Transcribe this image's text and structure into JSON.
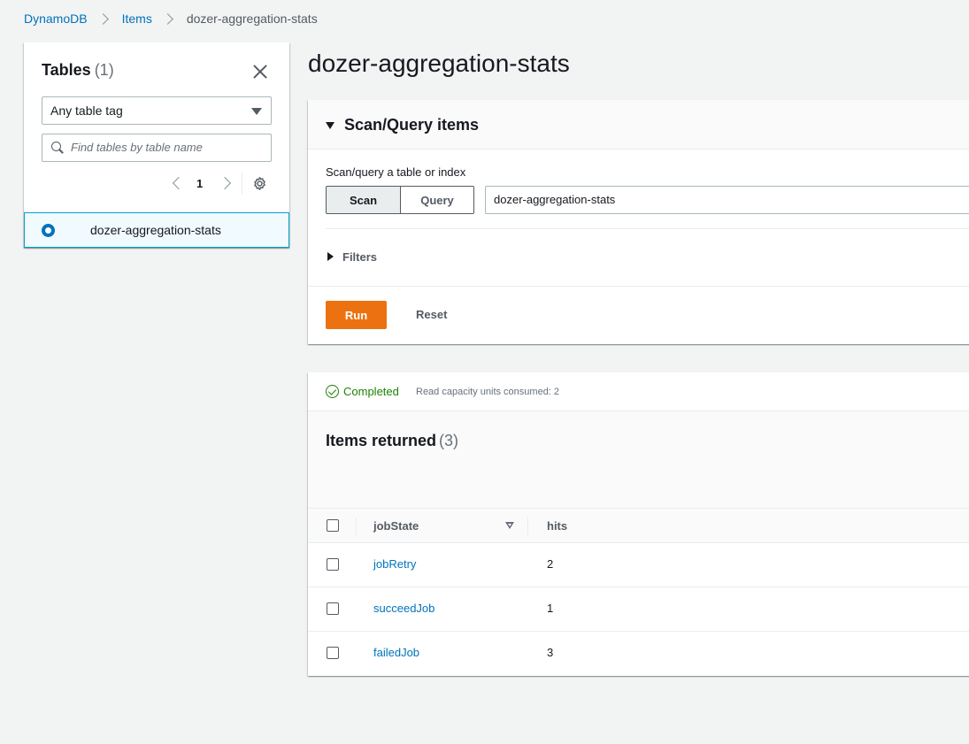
{
  "breadcrumb": {
    "items": [
      "DynamoDB",
      "Items"
    ],
    "current": "dozer-aggregation-stats"
  },
  "tables_panel": {
    "title": "Tables",
    "count": "(1)",
    "tag_filter": "Any table tag",
    "search_placeholder": "Find tables by table name",
    "page": "1",
    "tables": [
      {
        "name": "dozer-aggregation-stats",
        "selected": true
      }
    ]
  },
  "page_title": "dozer-aggregation-stats",
  "scan_query": {
    "title": "Scan/Query items",
    "label": "Scan/query a table or index",
    "mode_options": [
      "Scan",
      "Query"
    ],
    "selected_mode": "Scan",
    "selected_table": "dozer-aggregation-stats",
    "filters_label": "Filters",
    "run_label": "Run",
    "reset_label": "Reset"
  },
  "results": {
    "status": "Completed",
    "capacity": "Read capacity units consumed: 2",
    "title": "Items returned",
    "count": "(3)",
    "columns": [
      "jobState",
      "hits"
    ],
    "rows": [
      {
        "jobState": "jobRetry",
        "hits": "2"
      },
      {
        "jobState": "succeedJob",
        "hits": "1"
      },
      {
        "jobState": "failedJob",
        "hits": "3"
      }
    ]
  },
  "colors": {
    "link": "#0073bb",
    "primary_button": "#ec7211",
    "success": "#1d8102",
    "selected_border": "#00a1c9"
  }
}
